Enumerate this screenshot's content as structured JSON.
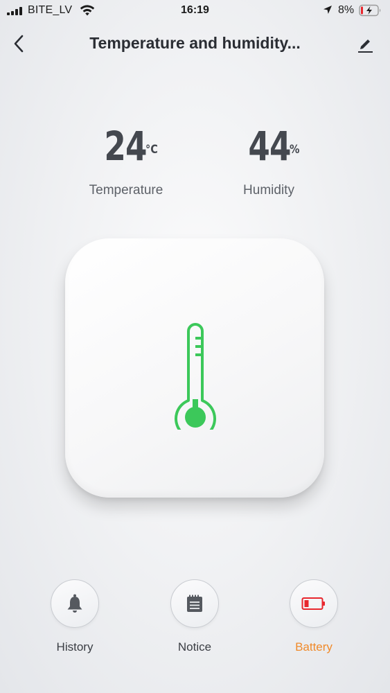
{
  "status_bar": {
    "carrier": "BITE_LV",
    "time": "16:19",
    "battery_percent": "8%"
  },
  "nav": {
    "title": "Temperature and humidity..."
  },
  "readings": {
    "temperature": {
      "value": "24",
      "unit": "°C",
      "label": "Temperature"
    },
    "humidity": {
      "value": "44",
      "unit": "%",
      "label": "Humidity"
    }
  },
  "device": {
    "icon": "thermometer-icon",
    "icon_color": "#3cc85a"
  },
  "actions": [
    {
      "label": "History",
      "icon": "bell-icon"
    },
    {
      "label": "Notice",
      "icon": "notepad-icon"
    },
    {
      "label": "Battery",
      "icon": "low-battery-icon",
      "color": "#f08a2a"
    }
  ],
  "colors": {
    "accent_orange": "#f08a2a",
    "battery_red": "#e8262d",
    "thermometer_green": "#3cc85a"
  }
}
